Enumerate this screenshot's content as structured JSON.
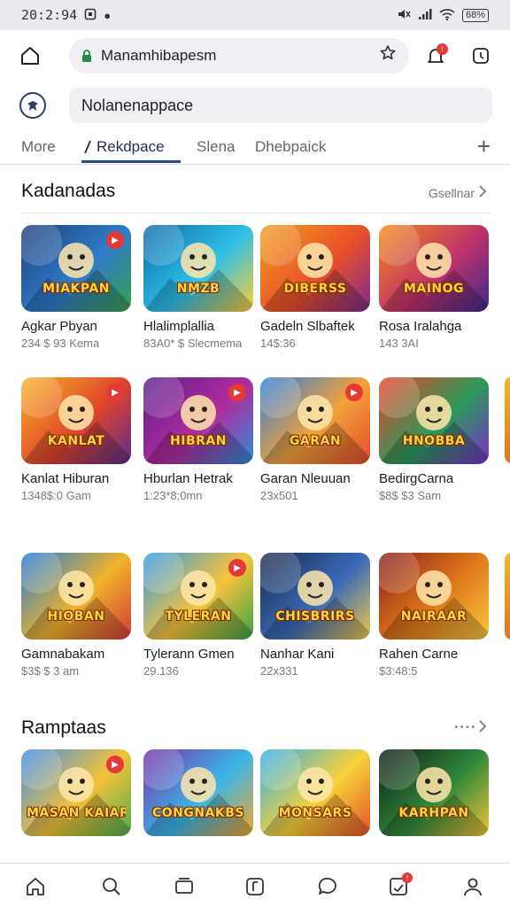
{
  "status": {
    "time": "20:2:94",
    "icons": [
      "alarm-icon",
      "dot-icon"
    ],
    "right_icons": [
      "mute-icon",
      "signal-icon",
      "wifi-icon"
    ],
    "battery": "68%"
  },
  "browser": {
    "url": "Manamhibapesm",
    "url_display": "Manamhibapesm",
    "badge": "!"
  },
  "search": {
    "value": "Nolanenappace"
  },
  "tabs": [
    {
      "label": "More"
    },
    {
      "label": "Rekdpace"
    },
    {
      "label": "Slena"
    },
    {
      "label": "Dhebpaick"
    }
  ],
  "sections": [
    {
      "title": "Kadanadas",
      "see_all": "Gsellnar",
      "rows": [
        [
          {
            "word": "MIAKPAN",
            "title": "Agkar Pbyan",
            "sub": "234 $ 93 Kema",
            "c1": "#1d3f7a",
            "c2": "#2f7bc8",
            "c3": "#3aa14a",
            "badge": "x"
          },
          {
            "word": "NMZB",
            "title": "Hlalimplallia",
            "sub": "83A0* $ Slecmema",
            "c1": "#0e6aa8",
            "c2": "#2fc0e8",
            "c3": "#ffcf33",
            "badge": ""
          },
          {
            "word": "DIBERSS",
            "title": "Gadeln Slbaftek",
            "sub": "14$:36",
            "c1": "#f0a01e",
            "c2": "#e8502a",
            "c3": "#7a2c8c",
            "badge": ""
          },
          {
            "word": "MAINOG",
            "title": "Rosa Iralahga",
            "sub": "143 3AI",
            "c1": "#f28a1a",
            "c2": "#c0326a",
            "c3": "#3d2a8a",
            "badge": ""
          }
        ],
        [
          {
            "word": "KANLAT",
            "title": "Kanlat Hiburan",
            "sub": "1348$:0 Gam",
            "c1": "#f7b52c",
            "c2": "#e0442a",
            "c3": "#5b2d8e",
            "badge": "x"
          },
          {
            "word": "HIBRAN",
            "title": "Hburlan Hetrak",
            "sub": "1:23*8:0mn",
            "c1": "#5a1e8c",
            "c2": "#b02c9c",
            "c3": "#2a8fd8",
            "badge": "x"
          },
          {
            "word": "GARAN",
            "title": "Garan Nleuuan",
            "sub": "23x501",
            "c1": "#2f7ed8",
            "c2": "#f2a23a",
            "c3": "#e24b2b",
            "badge": "x"
          },
          {
            "word": "HNOBBA",
            "title": "BedirgCarna",
            "sub": "$8$ $3 Sam",
            "c1": "#e8452a",
            "c2": "#2b9a5a",
            "c3": "#7a2fc8",
            "badge": ""
          }
        ],
        [
          {
            "word": "HIOBAN",
            "title": "Gamnabakam",
            "sub": "$3$ $ 3 am",
            "c1": "#1f7ad8",
            "c2": "#f0b42a",
            "c3": "#d03a3a",
            "badge": ""
          },
          {
            "word": "TYLERAN",
            "title": "Tylerann Gmen",
            "sub": "29.136",
            "c1": "#2f9be8",
            "c2": "#f7c43a",
            "c3": "#3aa14a",
            "badge": "x"
          },
          {
            "word": "CHISBRIRS",
            "title": "Nanhar Kani",
            "sub": "22x331",
            "c1": "#1a2a4a",
            "c2": "#3a6ab8",
            "c3": "#f0c84a",
            "badge": ""
          },
          {
            "word": "NAIRAAR",
            "title": "Rahen Carne",
            "sub": "$3:48:5",
            "c1": "#8a1e1e",
            "c2": "#e07a1a",
            "c3": "#f5c842",
            "badge": ""
          }
        ]
      ]
    },
    {
      "title": "Ramptaas",
      "see_all": "",
      "rows": [
        [
          {
            "word": "MASAN KAIAR",
            "title": "",
            "sub": "",
            "c1": "#3a8ee8",
            "c2": "#f4c23a",
            "c3": "#4cae4c",
            "badge": "x"
          },
          {
            "word": "CONGNAKBS",
            "title": "",
            "sub": "",
            "c1": "#7a2fa8",
            "c2": "#3ab6e8",
            "c3": "#f0a82a",
            "badge": ""
          },
          {
            "word": "MONSARS",
            "title": "",
            "sub": "",
            "c1": "#2fb0e8",
            "c2": "#f7d23a",
            "c3": "#e2532a",
            "badge": ""
          },
          {
            "word": "KARHPAN",
            "title": "",
            "sub": "",
            "c1": "#0e1a14",
            "c2": "#2f8a3a",
            "c3": "#f2c23a",
            "badge": ""
          }
        ]
      ]
    }
  ],
  "colors": {
    "accent": "#2a4a8a",
    "badge": "#e53935",
    "pill": "#eef0f3"
  }
}
